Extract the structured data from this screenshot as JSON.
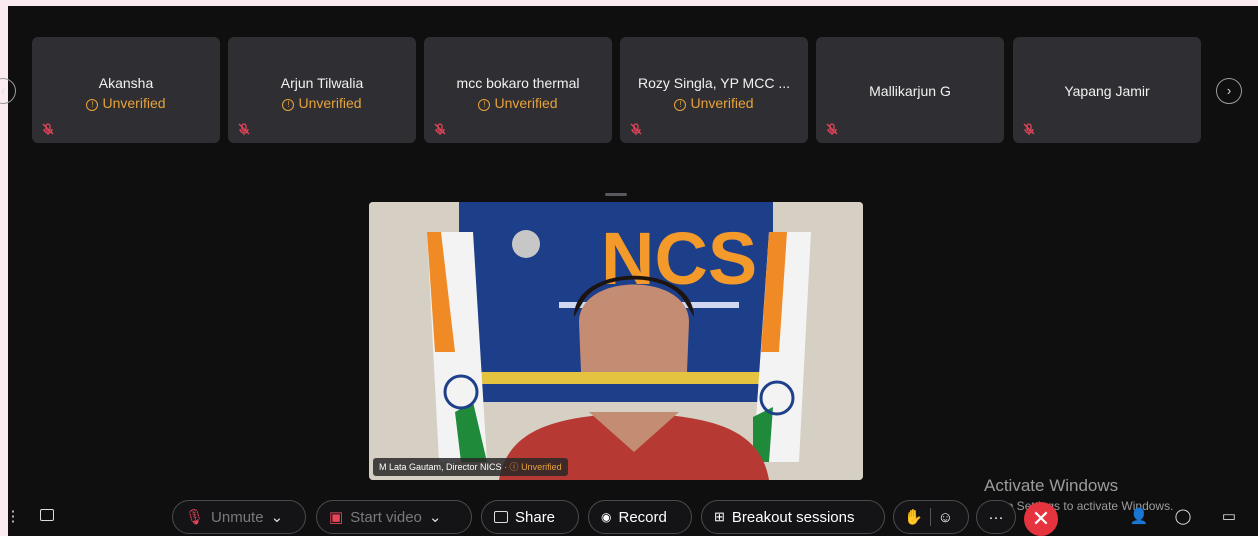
{
  "participants": [
    {
      "name": "Akansha",
      "status": "Unverified"
    },
    {
      "name": "Arjun Tilwalia",
      "status": "Unverified"
    },
    {
      "name": "mcc bokaro thermal",
      "status": "Unverified"
    },
    {
      "name": "Rozy Singla, YP MCC ...",
      "status": "Unverified"
    },
    {
      "name": "Mallikarjun G",
      "status": ""
    },
    {
      "name": "Yapang Jamir",
      "status": ""
    }
  ],
  "active_speaker": {
    "name": "M Lata Gautam, Director NICS",
    "status": "Unverified",
    "backdrop_text": "NCS"
  },
  "toolbar": {
    "unmute_label": "Unmute",
    "start_video_label": "Start video",
    "share_label": "Share",
    "record_label": "Record",
    "breakout_label": "Breakout sessions",
    "more_label": "···"
  },
  "windows_watermark": {
    "title": "Activate Windows",
    "subtitle": "Go to Settings to activate Windows."
  },
  "colors": {
    "unverified": "#e8a23a",
    "end_call": "#e5343d",
    "tile": "#2f2f33"
  }
}
